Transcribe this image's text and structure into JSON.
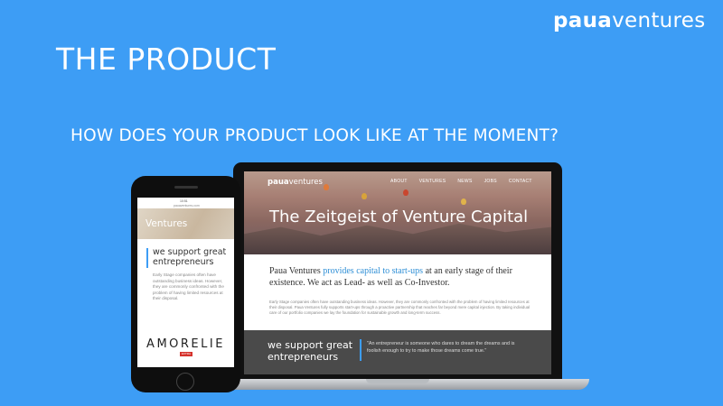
{
  "brand": {
    "bold": "paua",
    "light": "ventures"
  },
  "slide": {
    "title": "THE PRODUCT",
    "question": "HOW DOES YOUR PRODUCT LOOK LIKE AT THE MOMENT?"
  },
  "website": {
    "logo_bold": "paua",
    "logo_light": "ventures",
    "nav": [
      "ABOUT",
      "VENTURES",
      "NEWS",
      "JOBS",
      "CONTACT"
    ],
    "hero_title": "The Zeitgeist of Venture Capital",
    "intro_pre": "Paua Ventures ",
    "intro_highlight": "provides capital to start-ups",
    "intro_post": " at an early stage of their existence. We act as Lead- as well as Co-Investor.",
    "small_text": "Early Stage companies often have outstanding business ideas. However, they are commonly confronted with the problem of having limited resources at their disposal. Paua Ventures fully supports start-ups through a proactive partnership that reaches far beyond mere capital injection. By taking individual care of our portfolio companies we lay the foundation for sustainable growth and long-term success.",
    "support": "we support great\nentrepreneurs",
    "quote": "\"An entrepreneur is someone who dares to dream the dreams and is foolish enough to try to make those dreams come true.\""
  },
  "mobile": {
    "time": "10:51",
    "url": "pauaventures.com",
    "hero_label": "Ventures",
    "support": "we support great\nentrepreneurs",
    "body": "Early Stage companies often have outstanding business ideas. However, they are commonly confronted with the problem of having limited resources at their disposal.",
    "partner_logo": "AMORELIE",
    "partner_tag": "EXTRA"
  },
  "colors": {
    "background": "#3d9df5",
    "accent": "#3d9df5",
    "highlight": "#2f8fd6",
    "band": "#4a4a4a"
  }
}
